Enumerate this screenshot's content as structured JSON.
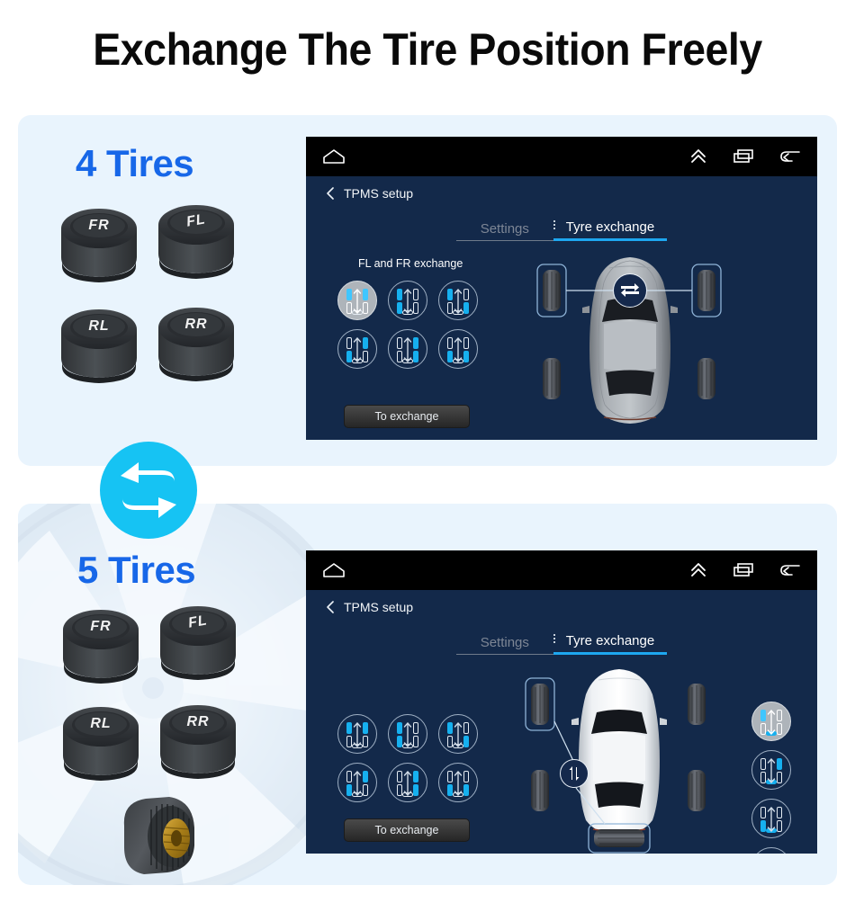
{
  "page": {
    "title": "Exchange The Tire Position Freely",
    "bg_color": "#ffffff",
    "panel_bg_color": "#e9f4fd",
    "accent_blue": "#1767e8",
    "cyan": "#16c3f3"
  },
  "panel_four": {
    "heading": "4 Tires",
    "sensors": [
      {
        "label": "FR"
      },
      {
        "label": "FL"
      },
      {
        "label": "RL"
      },
      {
        "label": "RR"
      }
    ]
  },
  "swap_badge": {
    "icon": "swap-arrows-icon"
  },
  "panel_five": {
    "heading": "5 Tires",
    "sensors": [
      {
        "label": "FR"
      },
      {
        "label": "FL"
      },
      {
        "label": "RL"
      },
      {
        "label": "RR"
      },
      {
        "label": ""
      }
    ]
  },
  "screen_four": {
    "screen_bg": "#13294a",
    "statusbar": {
      "home_icon": "home-icon",
      "expand_icon": "chevron-up-double-icon",
      "recents_icon": "recents-icon",
      "back_icon": "back-arrow-icon"
    },
    "appbar": {
      "back_icon": "chevron-left-icon",
      "title": "TPMS setup"
    },
    "tabs": [
      {
        "label": "Settings",
        "active": false
      },
      {
        "label": "Tyre exchange",
        "active": true
      }
    ],
    "section_label": "FL and FR exchange",
    "patterns": [
      {
        "name": "fl-fr-exchange",
        "selected": true,
        "tl": true,
        "tr": true,
        "bl": false,
        "br": false,
        "spare": false
      },
      {
        "name": "fl-rl-exchange",
        "selected": false,
        "tl": true,
        "tr": false,
        "bl": true,
        "br": false,
        "spare": false
      },
      {
        "name": "fl-rr-exchange",
        "selected": false,
        "tl": true,
        "tr": false,
        "bl": false,
        "br": true,
        "spare": false
      },
      {
        "name": "fr-rl-exchange",
        "selected": false,
        "tl": false,
        "tr": true,
        "bl": true,
        "br": false,
        "spare": false
      },
      {
        "name": "fr-rr-exchange",
        "selected": false,
        "tl": false,
        "tr": true,
        "bl": false,
        "br": true,
        "spare": false
      },
      {
        "name": "rl-rr-exchange",
        "selected": false,
        "tl": false,
        "tr": false,
        "bl": true,
        "br": true,
        "spare": false
      }
    ],
    "exchange_button": "To exchange",
    "car": {
      "color": "gray",
      "highlighted_tires": [
        "front-left",
        "front-right"
      ],
      "swap_icon": "swap-horizontal-icon"
    }
  },
  "screen_five": {
    "screen_bg": "#13294a",
    "statusbar": {
      "home_icon": "home-icon",
      "expand_icon": "chevron-up-double-icon",
      "recents_icon": "recents-icon",
      "back_icon": "back-arrow-icon"
    },
    "appbar": {
      "back_icon": "chevron-left-icon",
      "title": "TPMS setup"
    },
    "tabs": [
      {
        "label": "Settings",
        "active": false
      },
      {
        "label": "Tyre exchange",
        "active": true
      }
    ],
    "section_label": "",
    "patterns": [
      {
        "name": "fl-fr-exchange",
        "selected": false,
        "tl": true,
        "tr": true,
        "bl": false,
        "br": false,
        "spare": false
      },
      {
        "name": "fl-rl-exchange",
        "selected": false,
        "tl": true,
        "tr": false,
        "bl": true,
        "br": false,
        "spare": false
      },
      {
        "name": "fl-rr-exchange",
        "selected": false,
        "tl": true,
        "tr": false,
        "bl": false,
        "br": true,
        "spare": false
      },
      {
        "name": "fr-rl-exchange",
        "selected": false,
        "tl": false,
        "tr": true,
        "bl": true,
        "br": false,
        "spare": false
      },
      {
        "name": "fr-rr-exchange",
        "selected": false,
        "tl": false,
        "tr": true,
        "bl": false,
        "br": true,
        "spare": false
      },
      {
        "name": "rl-rr-exchange",
        "selected": false,
        "tl": false,
        "tr": false,
        "bl": true,
        "br": true,
        "spare": false
      }
    ],
    "spare_patterns": [
      {
        "name": "fl-spare-exchange",
        "selected": true,
        "tl": true,
        "tr": false,
        "bl": false,
        "br": false,
        "spare": true
      },
      {
        "name": "fr-spare-exchange",
        "selected": false,
        "tl": false,
        "tr": true,
        "bl": false,
        "br": false,
        "spare": true
      },
      {
        "name": "rl-spare-exchange",
        "selected": false,
        "tl": false,
        "tr": false,
        "bl": true,
        "br": false,
        "spare": true
      },
      {
        "name": "rr-spare-exchange",
        "selected": false,
        "tl": false,
        "tr": false,
        "bl": false,
        "br": true,
        "spare": true
      }
    ],
    "exchange_button": "To exchange",
    "car": {
      "color": "white",
      "highlighted_tires": [
        "front-left",
        "spare"
      ],
      "swap_icon": "swap-diagonal-icon"
    }
  }
}
